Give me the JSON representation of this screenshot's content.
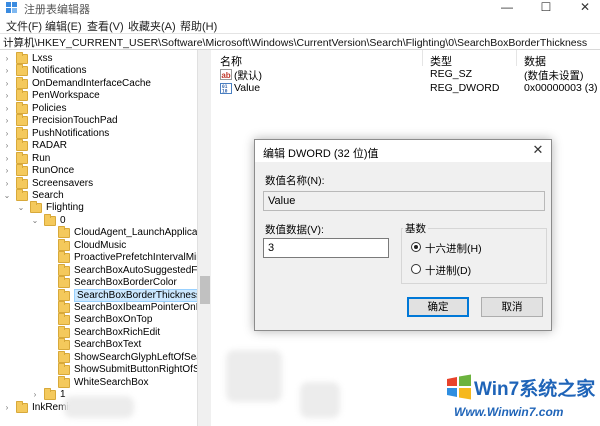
{
  "window": {
    "title": "注册表编辑器",
    "controls": {
      "minimize": "—",
      "maximize": "☐",
      "close": "✕"
    }
  },
  "menu": [
    "文件(F)",
    "编辑(E)",
    "查看(V)",
    "收藏夹(A)",
    "帮助(H)"
  ],
  "address": "计算机\\HKEY_CURRENT_USER\\Software\\Microsoft\\Windows\\CurrentVersion\\Search\\Flighting\\0\\SearchBoxBorderThickness",
  "tree": [
    {
      "label": "Lxss",
      "expanded": false,
      "selected": false
    },
    {
      "label": "Notifications",
      "expanded": false,
      "selected": false
    },
    {
      "label": "OnDemandInterfaceCache",
      "expanded": false,
      "selected": false
    },
    {
      "label": "PenWorkspace",
      "expanded": false,
      "selected": false
    },
    {
      "label": "Policies",
      "expanded": false,
      "selected": false
    },
    {
      "label": "PrecisionTouchPad",
      "expanded": false,
      "selected": false
    },
    {
      "label": "PushNotifications",
      "expanded": false,
      "selected": false
    },
    {
      "label": "RADAR",
      "expanded": false,
      "selected": false
    },
    {
      "label": "Run",
      "expanded": false,
      "selected": false
    },
    {
      "label": "RunOnce",
      "expanded": false,
      "selected": false
    },
    {
      "label": "Screensavers",
      "expanded": false,
      "selected": false
    },
    {
      "label": "Search",
      "expanded": true,
      "selected": false
    },
    {
      "label": "Flighting",
      "expanded": true,
      "selected": false
    },
    {
      "label": "0",
      "expanded": true,
      "selected": false
    },
    {
      "label": "CloudAgent_LaunchApplicati",
      "expanded": false,
      "selected": false
    },
    {
      "label": "CloudMusic",
      "expanded": false,
      "selected": false
    },
    {
      "label": "ProactivePrefetchIntervalMin",
      "expanded": false,
      "selected": false
    },
    {
      "label": "SearchBoxAutoSuggestedFo",
      "expanded": false,
      "selected": false
    },
    {
      "label": "SearchBoxBorderColor",
      "expanded": false,
      "selected": false
    },
    {
      "label": "SearchBoxBorderThickness",
      "expanded": false,
      "selected": true
    },
    {
      "label": "SearchBoxIbeamPointerOnH",
      "expanded": false,
      "selected": false
    },
    {
      "label": "SearchBoxOnTop",
      "expanded": false,
      "selected": false
    },
    {
      "label": "SearchBoxRichEdit",
      "expanded": false,
      "selected": false
    },
    {
      "label": "SearchBoxText",
      "expanded": false,
      "selected": false
    },
    {
      "label": "ShowSearchGlyphLeftOfSear",
      "expanded": false,
      "selected": false
    },
    {
      "label": "ShowSubmitButtonRightOfSe",
      "expanded": false,
      "selected": false
    },
    {
      "label": "WhiteSearchBox",
      "expanded": false,
      "selected": false
    },
    {
      "label": "1",
      "expanded": false,
      "selected": false
    },
    {
      "label": "InkReminder",
      "expanded": false,
      "selected": false
    }
  ],
  "values": {
    "headers": {
      "name": "名称",
      "type": "类型",
      "data": "数据"
    },
    "rows": [
      {
        "icon": "ab",
        "name": "(默认)",
        "type": "REG_SZ",
        "data": "(数值未设置)"
      },
      {
        "icon": "dword",
        "name": "Value",
        "type": "REG_DWORD",
        "data": "0x00000003 (3)"
      }
    ]
  },
  "dialog": {
    "title": "编辑 DWORD (32 位)值",
    "close": "✕",
    "name_label": "数值名称(N):",
    "name_value": "Value",
    "data_label": "数值数据(V):",
    "data_value": "3",
    "base_label": "基数",
    "hex_label": "十六进制(H)",
    "dec_label": "十进制(D)",
    "selected_base": "hex",
    "ok": "确定",
    "cancel": "取消"
  },
  "watermark": {
    "line1": "Win7系统之家",
    "line2": "Www.Winwin7.com"
  }
}
